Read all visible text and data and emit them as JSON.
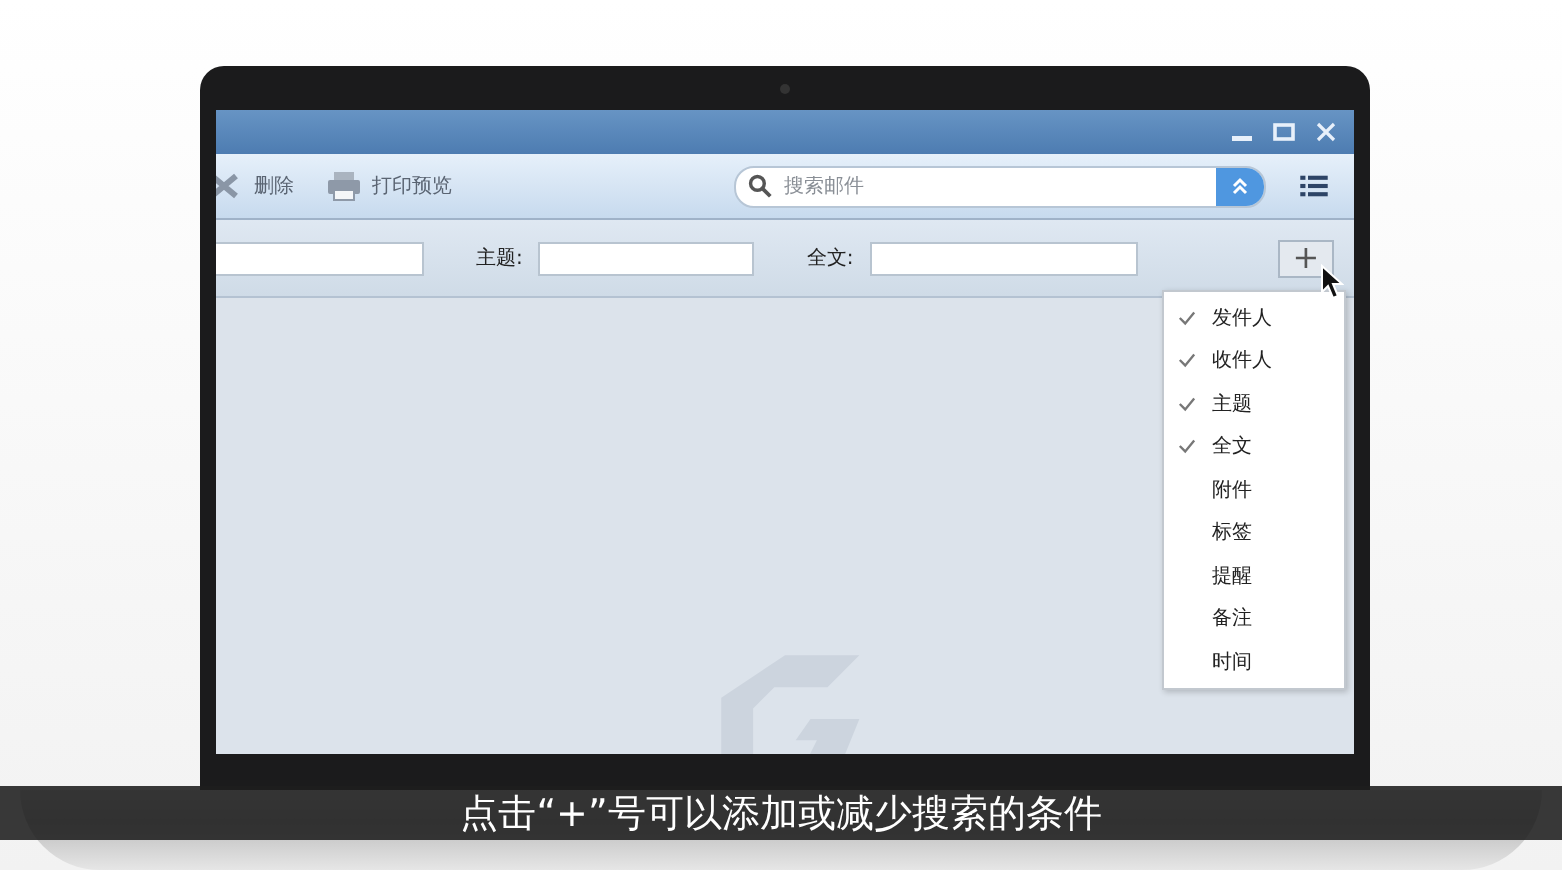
{
  "window": {
    "controls": [
      {
        "kind": "minimize"
      },
      {
        "kind": "maximize"
      },
      {
        "kind": "close"
      }
    ]
  },
  "toolbar": {
    "buttons": [
      {
        "kind": "delete",
        "label": "删除"
      },
      {
        "kind": "print",
        "label": "打印预览"
      }
    ],
    "search": {
      "placeholder": "搜索邮件"
    }
  },
  "filters": [
    {
      "kind": "field"
    },
    {
      "kind": "labeled",
      "label": "主题:"
    },
    {
      "kind": "labeled",
      "label": "全文:"
    }
  ],
  "add_button": {
    "label": "+"
  },
  "field_menu": [
    {
      "label": "发件人",
      "checked": true
    },
    {
      "label": "收件人",
      "checked": true
    },
    {
      "label": "主题",
      "checked": true
    },
    {
      "label": "全文",
      "checked": true
    },
    {
      "label": "附件",
      "checked": false
    },
    {
      "label": "标签",
      "checked": false
    },
    {
      "label": "提醒",
      "checked": false
    },
    {
      "label": "备注",
      "checked": false
    },
    {
      "label": "时间",
      "checked": false
    }
  ],
  "caption": "点击“+”号可以添加或减少搜索的条件"
}
